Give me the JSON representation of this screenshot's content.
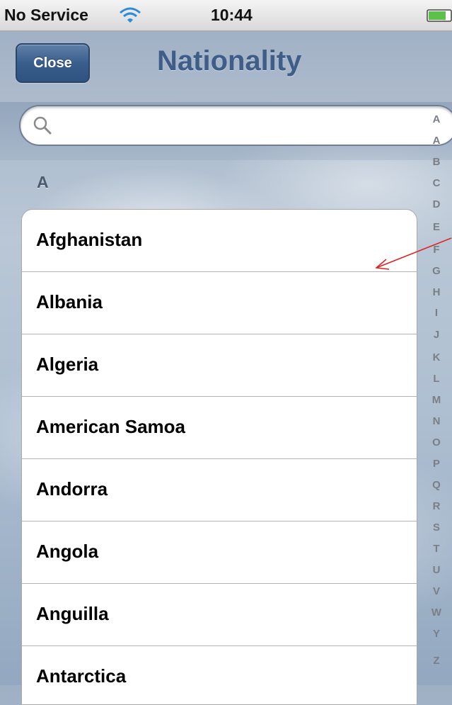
{
  "status_bar": {
    "carrier": "No Service",
    "time": "10:44",
    "wifi_icon": "wifi-icon",
    "battery_icon": "battery-icon"
  },
  "nav": {
    "close_label": "Close",
    "title": "Nationality"
  },
  "search": {
    "placeholder": "",
    "value": ""
  },
  "section": {
    "header": "A"
  },
  "countries": [
    "Afghanistan",
    "Albania",
    "Algeria",
    "American Samoa",
    "Andorra",
    "Angola",
    "Anguilla",
    "Antarctica"
  ],
  "index_letters": [
    "A",
    "A",
    "B",
    "C",
    "D",
    "E",
    "F",
    "G",
    "H",
    "I",
    "J",
    "K",
    "L",
    "M",
    "N",
    "O",
    "P",
    "Q",
    "R",
    "S",
    "T",
    "U",
    "V",
    "W",
    "Y",
    "Z"
  ],
  "colors": {
    "nav_title": "#3e5d88",
    "close_button": "#3a5e8c",
    "annotation": "#e02020"
  }
}
